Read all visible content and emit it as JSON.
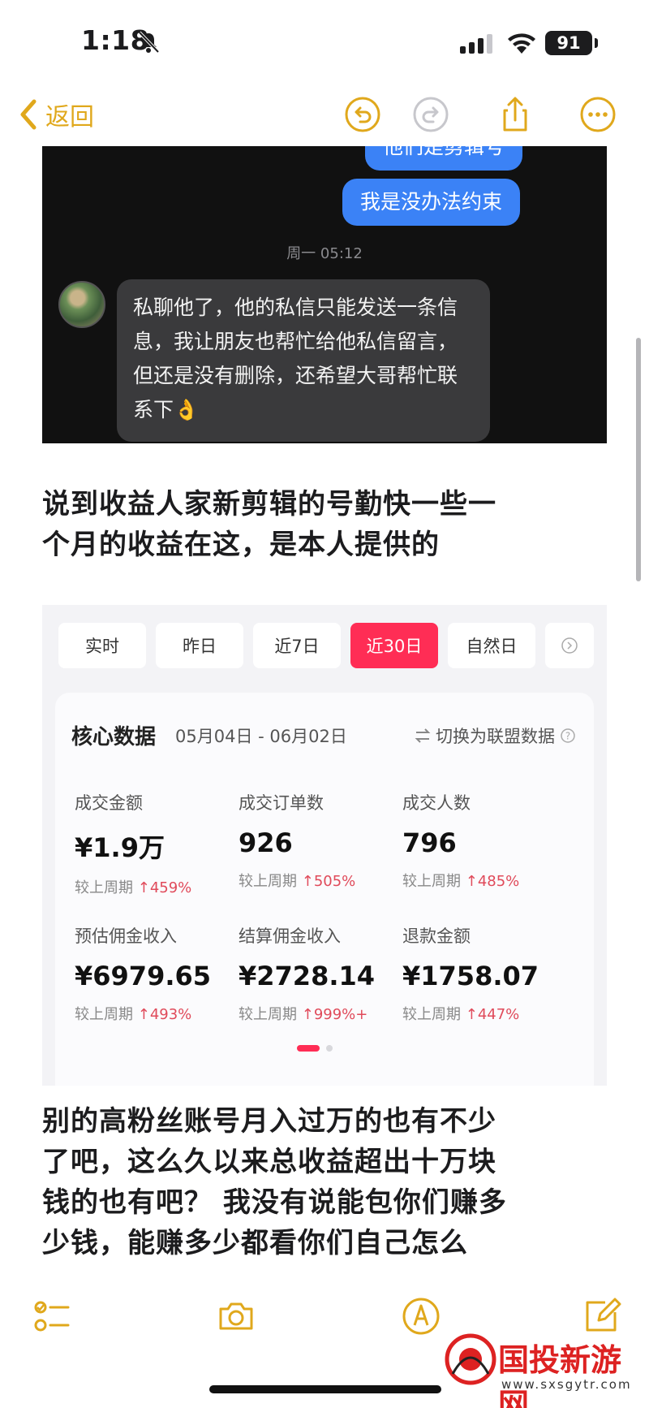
{
  "status_bar": {
    "time": "1:18",
    "battery": "91"
  },
  "nav": {
    "back_label": "返回"
  },
  "chat": {
    "partial_message": "他们是剪辑号",
    "sent_message": "我是没办法约束",
    "timestamp": "周一 05:12",
    "received_message": "私聊他了，他的私信只能发送一条信息，我让朋友也帮忙给他私信留言，但还是没有删除，还希望大哥帮忙联系下👌"
  },
  "paragraph1": {
    "line1": "说到收益人家新剪辑的号勤快一些一",
    "line2": "个月的收益在这，是本人提供的"
  },
  "dashboard": {
    "tabs": [
      "实时",
      "昨日",
      "近7日",
      "近30日",
      "自然日"
    ],
    "active_tab": "近30日",
    "core_title": "核心数据",
    "date_range": "05月04日 - 06月02日",
    "switch_label": "切换为联盟数据",
    "compare_label": "较上周期",
    "metrics": [
      {
        "label": "成交金额",
        "value": "¥1.9万",
        "change": "459%"
      },
      {
        "label": "成交订单数",
        "value": "926",
        "change": "505%"
      },
      {
        "label": "成交人数",
        "value": "796",
        "change": "485%"
      },
      {
        "label": "预估佣金收入",
        "value": "¥6979.65",
        "change": "493%"
      },
      {
        "label": "结算佣金收入",
        "value": "¥2728.14",
        "change": "999%+"
      },
      {
        "label": "退款金额",
        "value": "¥1758.07",
        "change": "447%"
      }
    ]
  },
  "paragraph2": {
    "line1": "别的高粉丝账号月入过万的也有不少",
    "line2": "了吧，这么久以来总收益超出十万块",
    "line3": "钱的也有吧？ 我没有说能包你们赚多",
    "line4": "少钱，能赚多少都看你们自己怎么"
  },
  "watermark": {
    "name": "国投新游网",
    "url": "www.sxsgytr.com"
  },
  "colors": {
    "accent": "#e0a81c",
    "bubble_blue": "#3b82f6",
    "active_tab": "#ff2d55",
    "increase": "#e04a5a"
  },
  "icons": [
    "bell-slash-icon",
    "signal-icon",
    "wifi-icon",
    "undo-icon",
    "redo-icon",
    "share-icon",
    "more-icon",
    "checklist-icon",
    "camera-icon",
    "markup-icon",
    "compose-icon"
  ]
}
